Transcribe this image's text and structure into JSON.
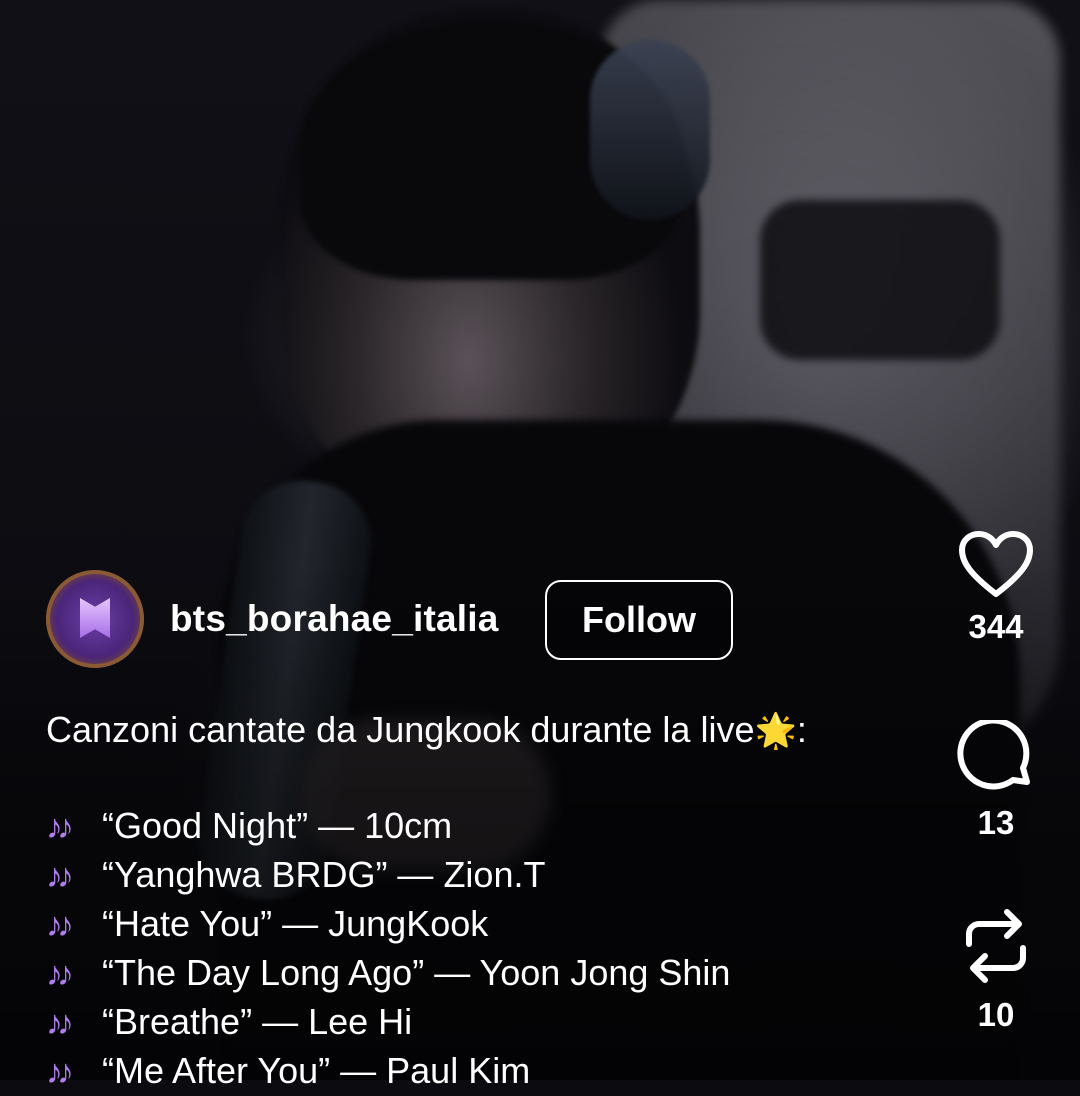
{
  "post": {
    "username": "bts_borahae_italia",
    "follow_label": "Follow",
    "caption_intro": "Canzoni cantate da Jungkook durante la live",
    "caption_intro_suffix": ":",
    "intro_icon": "sparkle-star-emoji",
    "song_icon": "musical-notes-emoji",
    "songs": [
      "“Good Night” — 10cm",
      "“Yanghwa BRDG” — Zion.T",
      "“Hate You” —  JungKook",
      "“The Day Long Ago” — Yoon Jong Shin",
      "“Breathe” — Lee Hi",
      "“Me After You” — Paul Kim"
    ]
  },
  "actions": {
    "like_count": "344",
    "comment_count": "13",
    "repost_count": "10"
  },
  "colors": {
    "text": "#ffffff",
    "note_emoji": "#b07cf0",
    "star_emoji": "#ffd54a"
  }
}
